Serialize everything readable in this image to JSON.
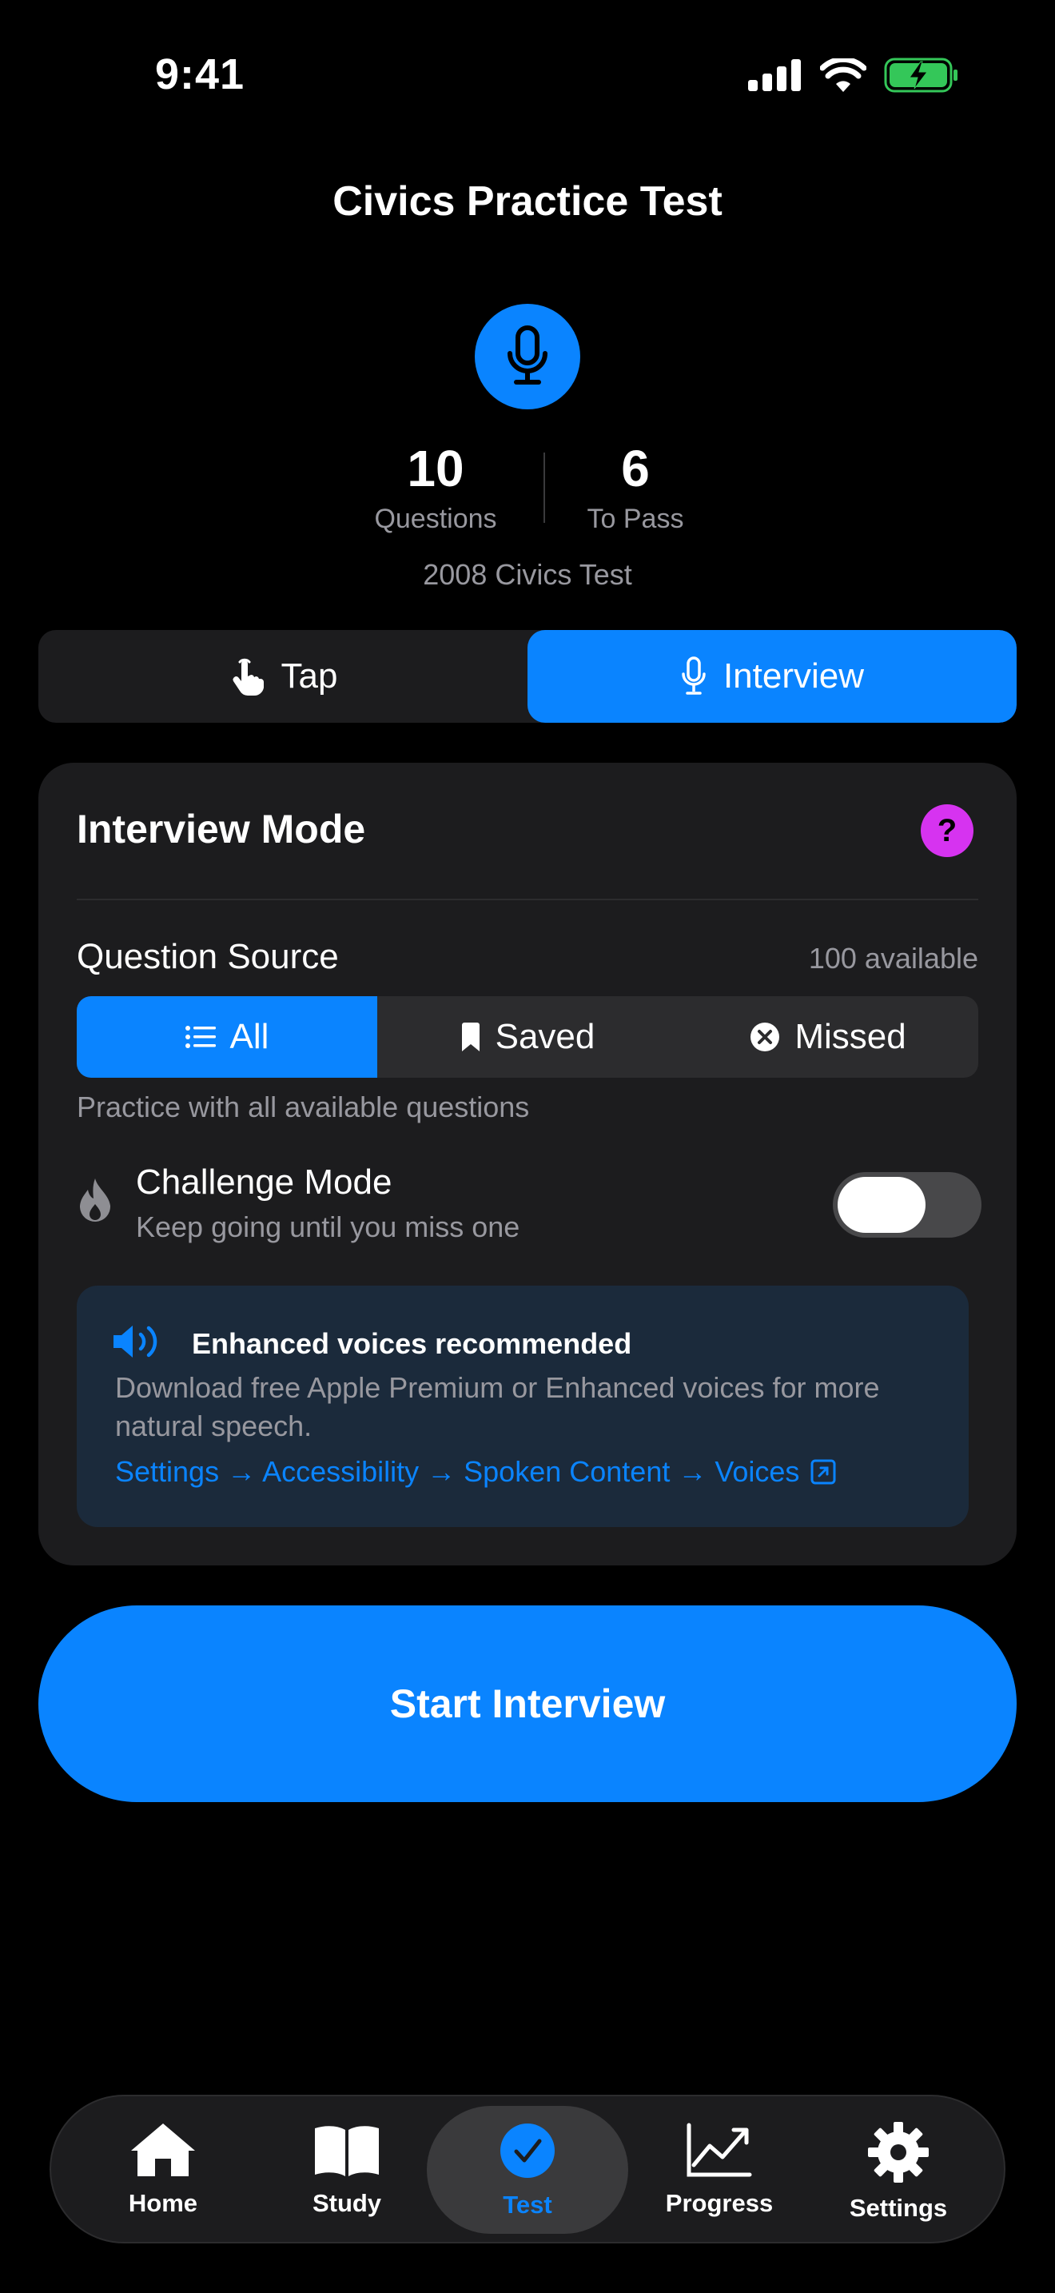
{
  "status_bar": {
    "time": "9:41"
  },
  "header": {
    "title": "Civics Practice Test"
  },
  "summary": {
    "questions_value": "10",
    "questions_label": "Questions",
    "to_pass_value": "6",
    "to_pass_label": "To Pass",
    "edition": "2008 Civics Test"
  },
  "mode_selector": {
    "options": [
      {
        "label": "Tap",
        "icon": "hand-tap-icon",
        "selected": false
      },
      {
        "label": "Interview",
        "icon": "microphone-icon",
        "selected": true
      }
    ]
  },
  "interview_card": {
    "title": "Interview Mode",
    "help_label": "?",
    "question_source_label": "Question Source",
    "available": "100 available",
    "sources": [
      {
        "label": "All",
        "icon": "list-icon",
        "selected": true
      },
      {
        "label": "Saved",
        "icon": "bookmark-icon",
        "selected": false
      },
      {
        "label": "Missed",
        "icon": "x-circle-icon",
        "selected": false
      }
    ],
    "source_description": "Practice with all available questions",
    "challenge_title": "Challenge Mode",
    "challenge_subtitle": "Keep going until you miss one",
    "challenge_enabled": false,
    "voices": {
      "title": "Enhanced voices recommended",
      "description": "Download free Apple Premium or Enhanced voices for more natural speech.",
      "path": "Settings → Accessibility → Spoken Content → Voices"
    }
  },
  "start_button": {
    "label": "Start Interview"
  },
  "tab_bar": {
    "tabs": [
      {
        "label": "Home",
        "icon": "house-icon"
      },
      {
        "label": "Study",
        "icon": "book-icon"
      },
      {
        "label": "Test",
        "icon": "checkmark-circle-icon",
        "selected": true
      },
      {
        "label": "Progress",
        "icon": "chart-line-icon"
      },
      {
        "label": "Settings",
        "icon": "gear-icon"
      }
    ]
  },
  "colors": {
    "accent": "#0A84FF",
    "help": "#D633F0",
    "card": "#1C1C1E",
    "voices_box": "#1B2A3B",
    "battery": "#34C759"
  }
}
